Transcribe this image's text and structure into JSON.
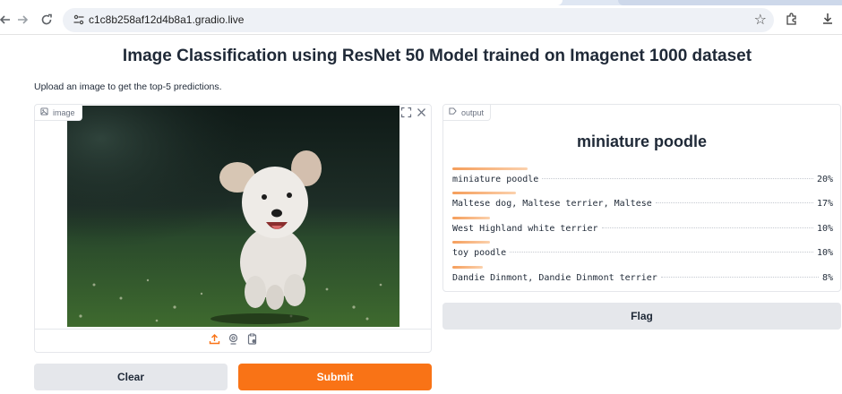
{
  "browser": {
    "url": "c1c8b258af12d4b8a1.gradio.live",
    "icons": [
      "back-arrow-icon",
      "forward-arrow-icon",
      "reload-icon",
      "site-info-icon",
      "bookmark-star-icon",
      "extensions-icon",
      "download-icon"
    ]
  },
  "page": {
    "title": "Image Classification using ResNet 50 Model trained on Imagenet 1000 dataset",
    "description": "Upload an image to get the top-5 predictions."
  },
  "image_panel": {
    "label": "image",
    "toolbar_icons": [
      "fullscreen-icon",
      "close-icon"
    ],
    "source_icons": [
      "upload-icon",
      "webcam-icon",
      "clipboard-icon"
    ]
  },
  "output_panel": {
    "label": "output",
    "top_label": "miniature poodle",
    "confidences": [
      {
        "label": "miniature poodle",
        "pct": "20%",
        "value": 0.2
      },
      {
        "label": "Maltese dog, Maltese terrier, Maltese",
        "pct": "17%",
        "value": 0.17
      },
      {
        "label": "West Highland white terrier",
        "pct": "10%",
        "value": 0.1
      },
      {
        "label": "toy poodle",
        "pct": "10%",
        "value": 0.1
      },
      {
        "label": "Dandie Dinmont, Dandie Dinmont terrier",
        "pct": "8%",
        "value": 0.08
      }
    ]
  },
  "buttons": {
    "flag": "Flag",
    "clear": "Clear",
    "submit": "Submit"
  },
  "colors": {
    "accent": "#f97316",
    "secondary_button": "#e5e7eb",
    "bar_start": "#f59e5b",
    "bar_end": "#fbd1ad"
  }
}
